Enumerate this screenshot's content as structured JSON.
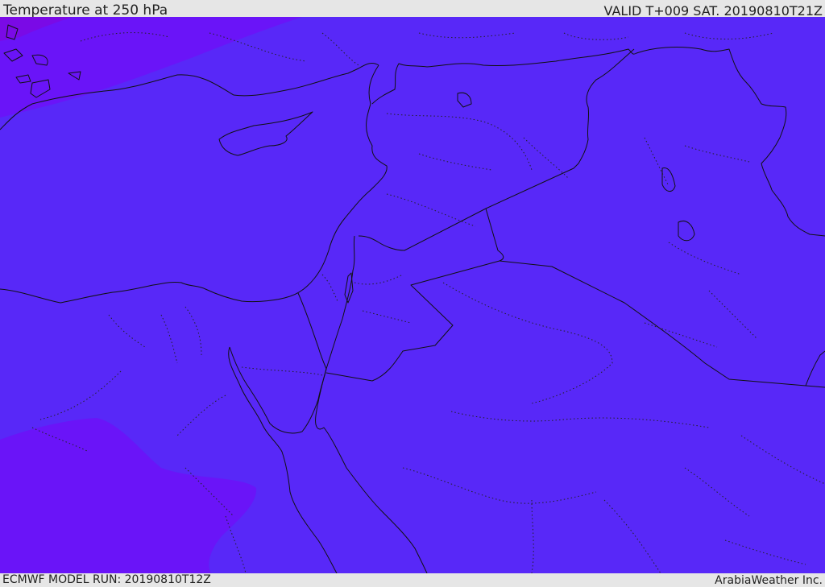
{
  "header": {
    "title": "Temperature at 250 hPa",
    "valid": "VALID T+009 SAT. 20190810T21Z"
  },
  "footer": {
    "model_run": "ECMWF MODEL RUN: 20190810T12Z",
    "credit": "ArabiaWeather Inc."
  },
  "colors": {
    "field_main": "#5828f8",
    "field_cold": "#6a14f8",
    "field_coldest": "#7a0ae6",
    "bar": "#e6e6e6",
    "lines": "#111111"
  }
}
